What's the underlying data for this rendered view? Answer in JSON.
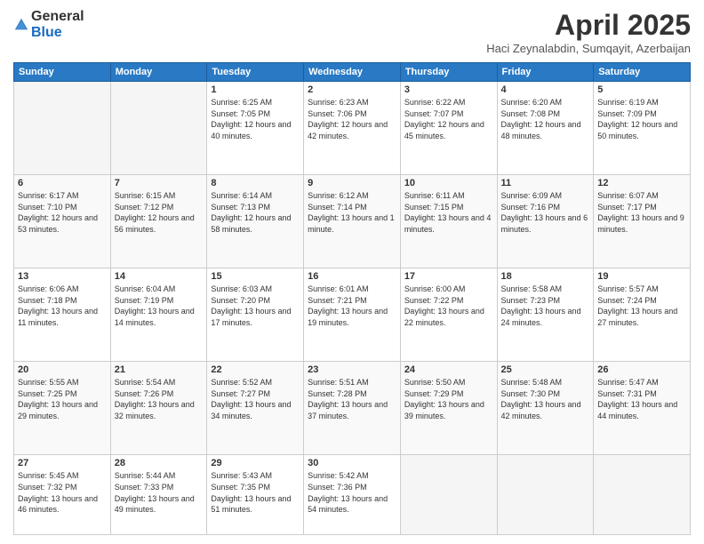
{
  "header": {
    "logo_general": "General",
    "logo_blue": "Blue",
    "month_title": "April 2025",
    "location": "Haci Zeynalabdin, Sumqayit, Azerbaijan"
  },
  "weekdays": [
    "Sunday",
    "Monday",
    "Tuesday",
    "Wednesday",
    "Thursday",
    "Friday",
    "Saturday"
  ],
  "weeks": [
    [
      {
        "day": "",
        "sunrise": "",
        "sunset": "",
        "daylight": ""
      },
      {
        "day": "",
        "sunrise": "",
        "sunset": "",
        "daylight": ""
      },
      {
        "day": "1",
        "sunrise": "Sunrise: 6:25 AM",
        "sunset": "Sunset: 7:05 PM",
        "daylight": "Daylight: 12 hours and 40 minutes."
      },
      {
        "day": "2",
        "sunrise": "Sunrise: 6:23 AM",
        "sunset": "Sunset: 7:06 PM",
        "daylight": "Daylight: 12 hours and 42 minutes."
      },
      {
        "day": "3",
        "sunrise": "Sunrise: 6:22 AM",
        "sunset": "Sunset: 7:07 PM",
        "daylight": "Daylight: 12 hours and 45 minutes."
      },
      {
        "day": "4",
        "sunrise": "Sunrise: 6:20 AM",
        "sunset": "Sunset: 7:08 PM",
        "daylight": "Daylight: 12 hours and 48 minutes."
      },
      {
        "day": "5",
        "sunrise": "Sunrise: 6:19 AM",
        "sunset": "Sunset: 7:09 PM",
        "daylight": "Daylight: 12 hours and 50 minutes."
      }
    ],
    [
      {
        "day": "6",
        "sunrise": "Sunrise: 6:17 AM",
        "sunset": "Sunset: 7:10 PM",
        "daylight": "Daylight: 12 hours and 53 minutes."
      },
      {
        "day": "7",
        "sunrise": "Sunrise: 6:15 AM",
        "sunset": "Sunset: 7:12 PM",
        "daylight": "Daylight: 12 hours and 56 minutes."
      },
      {
        "day": "8",
        "sunrise": "Sunrise: 6:14 AM",
        "sunset": "Sunset: 7:13 PM",
        "daylight": "Daylight: 12 hours and 58 minutes."
      },
      {
        "day": "9",
        "sunrise": "Sunrise: 6:12 AM",
        "sunset": "Sunset: 7:14 PM",
        "daylight": "Daylight: 13 hours and 1 minute."
      },
      {
        "day": "10",
        "sunrise": "Sunrise: 6:11 AM",
        "sunset": "Sunset: 7:15 PM",
        "daylight": "Daylight: 13 hours and 4 minutes."
      },
      {
        "day": "11",
        "sunrise": "Sunrise: 6:09 AM",
        "sunset": "Sunset: 7:16 PM",
        "daylight": "Daylight: 13 hours and 6 minutes."
      },
      {
        "day": "12",
        "sunrise": "Sunrise: 6:07 AM",
        "sunset": "Sunset: 7:17 PM",
        "daylight": "Daylight: 13 hours and 9 minutes."
      }
    ],
    [
      {
        "day": "13",
        "sunrise": "Sunrise: 6:06 AM",
        "sunset": "Sunset: 7:18 PM",
        "daylight": "Daylight: 13 hours and 11 minutes."
      },
      {
        "day": "14",
        "sunrise": "Sunrise: 6:04 AM",
        "sunset": "Sunset: 7:19 PM",
        "daylight": "Daylight: 13 hours and 14 minutes."
      },
      {
        "day": "15",
        "sunrise": "Sunrise: 6:03 AM",
        "sunset": "Sunset: 7:20 PM",
        "daylight": "Daylight: 13 hours and 17 minutes."
      },
      {
        "day": "16",
        "sunrise": "Sunrise: 6:01 AM",
        "sunset": "Sunset: 7:21 PM",
        "daylight": "Daylight: 13 hours and 19 minutes."
      },
      {
        "day": "17",
        "sunrise": "Sunrise: 6:00 AM",
        "sunset": "Sunset: 7:22 PM",
        "daylight": "Daylight: 13 hours and 22 minutes."
      },
      {
        "day": "18",
        "sunrise": "Sunrise: 5:58 AM",
        "sunset": "Sunset: 7:23 PM",
        "daylight": "Daylight: 13 hours and 24 minutes."
      },
      {
        "day": "19",
        "sunrise": "Sunrise: 5:57 AM",
        "sunset": "Sunset: 7:24 PM",
        "daylight": "Daylight: 13 hours and 27 minutes."
      }
    ],
    [
      {
        "day": "20",
        "sunrise": "Sunrise: 5:55 AM",
        "sunset": "Sunset: 7:25 PM",
        "daylight": "Daylight: 13 hours and 29 minutes."
      },
      {
        "day": "21",
        "sunrise": "Sunrise: 5:54 AM",
        "sunset": "Sunset: 7:26 PM",
        "daylight": "Daylight: 13 hours and 32 minutes."
      },
      {
        "day": "22",
        "sunrise": "Sunrise: 5:52 AM",
        "sunset": "Sunset: 7:27 PM",
        "daylight": "Daylight: 13 hours and 34 minutes."
      },
      {
        "day": "23",
        "sunrise": "Sunrise: 5:51 AM",
        "sunset": "Sunset: 7:28 PM",
        "daylight": "Daylight: 13 hours and 37 minutes."
      },
      {
        "day": "24",
        "sunrise": "Sunrise: 5:50 AM",
        "sunset": "Sunset: 7:29 PM",
        "daylight": "Daylight: 13 hours and 39 minutes."
      },
      {
        "day": "25",
        "sunrise": "Sunrise: 5:48 AM",
        "sunset": "Sunset: 7:30 PM",
        "daylight": "Daylight: 13 hours and 42 minutes."
      },
      {
        "day": "26",
        "sunrise": "Sunrise: 5:47 AM",
        "sunset": "Sunset: 7:31 PM",
        "daylight": "Daylight: 13 hours and 44 minutes."
      }
    ],
    [
      {
        "day": "27",
        "sunrise": "Sunrise: 5:45 AM",
        "sunset": "Sunset: 7:32 PM",
        "daylight": "Daylight: 13 hours and 46 minutes."
      },
      {
        "day": "28",
        "sunrise": "Sunrise: 5:44 AM",
        "sunset": "Sunset: 7:33 PM",
        "daylight": "Daylight: 13 hours and 49 minutes."
      },
      {
        "day": "29",
        "sunrise": "Sunrise: 5:43 AM",
        "sunset": "Sunset: 7:35 PM",
        "daylight": "Daylight: 13 hours and 51 minutes."
      },
      {
        "day": "30",
        "sunrise": "Sunrise: 5:42 AM",
        "sunset": "Sunset: 7:36 PM",
        "daylight": "Daylight: 13 hours and 54 minutes."
      },
      {
        "day": "",
        "sunrise": "",
        "sunset": "",
        "daylight": ""
      },
      {
        "day": "",
        "sunrise": "",
        "sunset": "",
        "daylight": ""
      },
      {
        "day": "",
        "sunrise": "",
        "sunset": "",
        "daylight": ""
      }
    ]
  ]
}
